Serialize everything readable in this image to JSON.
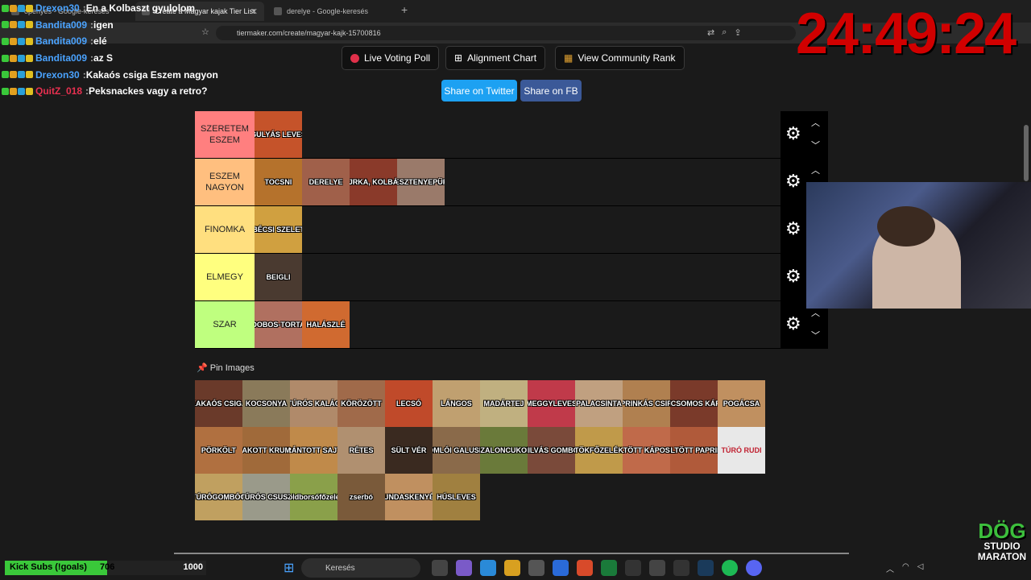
{
  "browser": {
    "tabs": [
      {
        "title": "openyes - Google-keresés",
        "active": false
      },
      {
        "title": "Create a Magyar kajak Tier List",
        "active": true
      },
      {
        "title": "derelye - Google-keresés",
        "active": false
      }
    ],
    "new_tab": "+",
    "url": "tiermaker.com/create/magyar-kajk-15700816"
  },
  "toolbar": {
    "live_voting": "Live Voting Poll",
    "alignment": "Alignment Chart",
    "community": "View Community Rank",
    "share_twitter": "Share on Twitter",
    "share_fb": "Share on FB"
  },
  "tiers": [
    {
      "label": "SZERETEM ESZEM",
      "color": "#ff7f7f",
      "items": [
        {
          "name": "GULYÁS LEVES",
          "color": "#c5532a"
        }
      ]
    },
    {
      "label": "ESZEM NAGYON",
      "color": "#ffbf7f",
      "items": [
        {
          "name": "TOCSNI",
          "color": "#b5722c"
        },
        {
          "name": "DERELYE",
          "color": "#a0604a"
        },
        {
          "name": "JRKA, KOLBÁ",
          "color": "#8a3a2a"
        },
        {
          "name": "GESZTENYEPÜRÉ",
          "color": "#9a7a6a"
        }
      ]
    },
    {
      "label": "FINOMKA",
      "color": "#ffdf7f",
      "items": [
        {
          "name": "BÉCSI SZELET",
          "color": "#d0a040"
        }
      ]
    },
    {
      "label": "ELMEGY",
      "color": "#ffff7f",
      "items": [
        {
          "name": "BEIGLI",
          "color": "#4a3a30"
        }
      ]
    },
    {
      "label": "SZAR",
      "color": "#bfff7f",
      "items": [
        {
          "name": "DOBOS-TORTA",
          "color": "#b07060"
        },
        {
          "name": "HALÁSZLÉ",
          "color": "#d06a30"
        }
      ]
    }
  ],
  "pin_label": "Pin Images",
  "pool": [
    {
      "name": "KAKAÓS CSIGA",
      "color": "#6a3a2a"
    },
    {
      "name": "KOCSONYA",
      "color": "#8a7a5a"
    },
    {
      "name": "TÚRÓS KALÁC",
      "color": "#b08a6a"
    },
    {
      "name": "KÖRÖZÖTT",
      "color": "#a06a4a"
    },
    {
      "name": "LECSÓ",
      "color": "#c04a2a"
    },
    {
      "name": "LÁNGOS",
      "color": "#c0a070"
    },
    {
      "name": "MADÁRTEJ",
      "color": "#c0b080"
    },
    {
      "name": "MEGGYLEVES",
      "color": "#c03a4a"
    },
    {
      "name": "PALACSINTA",
      "color": "#c0a080"
    },
    {
      "name": "PRINKÁS CSIR",
      "color": "#b08050"
    },
    {
      "name": "PARADICSOMOS KÁPOSZTA",
      "color": "#7a3a2a"
    },
    {
      "name": "POGÁCSA",
      "color": "#c09060"
    },
    {
      "name": "PÖRKÖLT",
      "color": "#b07040"
    },
    {
      "name": "RAKOTT KRUMP",
      "color": "#a06a3a"
    },
    {
      "name": "RÁNTOTT SAJT",
      "color": "#c08a4a"
    },
    {
      "name": "RÉTES",
      "color": "#b09070"
    },
    {
      "name": "SÜLT VÉR",
      "color": "#3a2a20"
    },
    {
      "name": "SOMLÓI GALUSKA",
      "color": "#8a6a4a"
    },
    {
      "name": "SZALONCUKOR",
      "color": "#6a7a3a"
    },
    {
      "name": "SZILVÁS GOMBÓC",
      "color": "#7a4a3a"
    },
    {
      "name": "TÖKFŐZELÉK",
      "color": "#c09a4a"
    },
    {
      "name": "TÖLTÖTT KÁPOSZTA",
      "color": "#c06a4a"
    },
    {
      "name": "TÖLTÖTT PAPRIKA",
      "color": "#b05a3a"
    },
    {
      "name": "TÚRÓ RUDI",
      "color": "#e8e8e8"
    },
    {
      "name": "TÚRÓGOMBÓC",
      "color": "#c0a060"
    },
    {
      "name": "TÚRÓS CSUSZ",
      "color": "#9a9a8a"
    },
    {
      "name": "Zöldborsófőzelék",
      "color": "#8aa04a"
    },
    {
      "name": "zserbó",
      "color": "#7a5a3a"
    },
    {
      "name": "KUNDASKENYÉR",
      "color": "#c09060"
    },
    {
      "name": "HÚSLEVES",
      "color": "#a08040"
    }
  ],
  "chat": [
    {
      "user": "Drexon30",
      "user_color": "#4aa3ff",
      "text": "En a Kolbaszt gyulolom"
    },
    {
      "user": "Bandita009",
      "user_color": "#4aa3ff",
      "text": "igen"
    },
    {
      "user": "Bandita009",
      "user_color": "#4aa3ff",
      "text": "elé"
    },
    {
      "user": "Bandita009",
      "user_color": "#4aa3ff",
      "text": "az S"
    },
    {
      "user": "Drexon30",
      "user_color": "#4aa3ff",
      "text": "Kakaós csiga Eszem nagyon"
    },
    {
      "user": "QuitZ_018",
      "user_color": "#e83050",
      "text": "Peksnackes vagy a retro?"
    }
  ],
  "timer": "24:49:24",
  "subs": {
    "label": "Kick Subs (!goals)",
    "current": "706",
    "goal": "1000",
    "progress": 0.706
  },
  "logo": {
    "line1": "DÖG",
    "line2": "STUDIO",
    "line3": "MARATON"
  },
  "taskbar": {
    "search": "Keresés"
  }
}
